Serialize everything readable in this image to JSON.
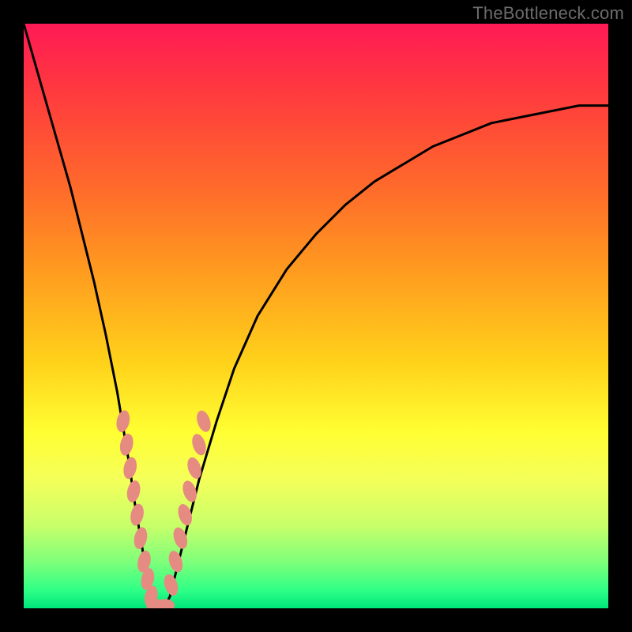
{
  "watermark": "TheBottleneck.com",
  "colors": {
    "curve": "#000000",
    "markers": "#e58b81",
    "frame": "#000000"
  },
  "chart_data": {
    "type": "line",
    "title": "",
    "xlabel": "",
    "ylabel": "",
    "xlim": [
      0,
      100
    ],
    "ylim": [
      0,
      100
    ],
    "grid": false,
    "series": [
      {
        "name": "bottleneck-curve",
        "x": [
          0,
          2,
          4,
          6,
          8,
          10,
          12,
          14,
          16,
          18,
          19,
          20,
          21,
          22,
          23,
          24,
          25,
          26,
          28,
          30,
          33,
          36,
          40,
          45,
          50,
          55,
          60,
          65,
          70,
          75,
          80,
          85,
          90,
          95,
          100
        ],
        "y": [
          100,
          93,
          86,
          79,
          72,
          64,
          56,
          47,
          37,
          25,
          18,
          12,
          6,
          1,
          0,
          0,
          2,
          6,
          14,
          22,
          32,
          41,
          50,
          58,
          64,
          69,
          73,
          76,
          79,
          81,
          83,
          84,
          85,
          86,
          86
        ]
      }
    ],
    "markers": {
      "left_branch": [
        {
          "x": 17.0,
          "y": 32
        },
        {
          "x": 17.6,
          "y": 28
        },
        {
          "x": 18.2,
          "y": 24
        },
        {
          "x": 18.8,
          "y": 20
        },
        {
          "x": 19.4,
          "y": 16
        },
        {
          "x": 20.0,
          "y": 12
        },
        {
          "x": 20.6,
          "y": 8
        },
        {
          "x": 21.2,
          "y": 5
        },
        {
          "x": 21.8,
          "y": 2
        }
      ],
      "right_branch": [
        {
          "x": 25.2,
          "y": 4
        },
        {
          "x": 26.0,
          "y": 8
        },
        {
          "x": 26.8,
          "y": 12
        },
        {
          "x": 27.6,
          "y": 16
        },
        {
          "x": 28.4,
          "y": 20
        },
        {
          "x": 29.2,
          "y": 24
        },
        {
          "x": 30.0,
          "y": 28
        },
        {
          "x": 30.8,
          "y": 32
        }
      ],
      "bottom": [
        {
          "x": 22.6,
          "y": 0.5
        },
        {
          "x": 23.4,
          "y": 0.2
        },
        {
          "x": 24.2,
          "y": 0.5
        }
      ]
    }
  }
}
